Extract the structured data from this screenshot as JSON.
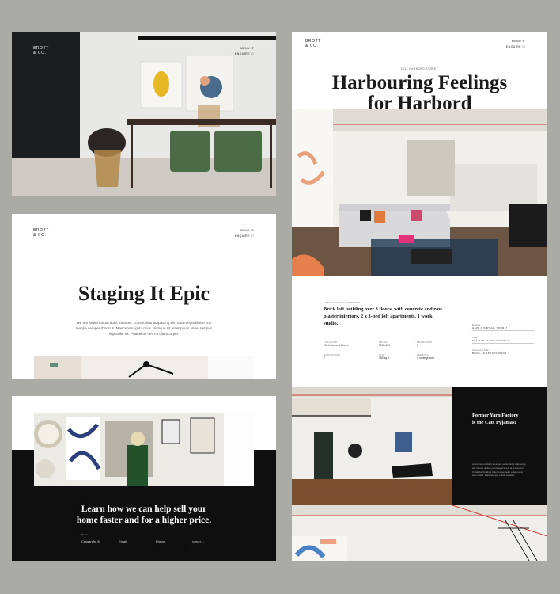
{
  "brand": {
    "logo_line1": "BROTT",
    "logo_line2": "& CO."
  },
  "nav": {
    "menu_label": "MENU ☰",
    "enquire_label": "ENQUIRE ☐"
  },
  "card_staging": {
    "title": "Staging It Epic",
    "body": "We are lorem ipsum dolor sit amet, consectetur adipiscing elit. Etiam eget libero non magna semper rhoncus. Maecenas ligula risus, tristique sit amet purus vitae, tempus imperdiet ex. Phasellus nec mi ullamcorper."
  },
  "card_contact": {
    "headline_line1": "Learn how we can help sell your",
    "headline_line2": "home faster and for a higher price.",
    "fields": [
      {
        "label": "Name",
        "value": "Cassandra M"
      },
      {
        "label": "",
        "value": "Email"
      },
      {
        "label": "",
        "value": "Phone"
      }
    ],
    "submit_label": "SUBMIT →"
  },
  "card_harbord": {
    "address": "1014 HARBORD STREET",
    "title_line1": "Harbouring Feelings",
    "title_line2": "for Harbord",
    "section_label": "CASE STUDY / OVERVIEW",
    "description": "Brick loft building over 3 floors, with concrete and raw plaster interiors. 2 x 3-bed loft apartments, 1 work studio.",
    "details": [
      {
        "label": "LOCATION",
        "value": "1014 Harbord Street"
      },
      {
        "label": "PRICE",
        "value": "$995,000"
      },
      {
        "label": "BEDROOMS",
        "value": "3"
      },
      {
        "label": "BATHROOMS",
        "value": "2"
      },
      {
        "label": "SIZE",
        "value": "180 sq ft"
      },
      {
        "label": "PARKING",
        "value": "1 underground"
      }
    ],
    "links": [
      {
        "label": "Enquire",
        "value": "HAVE A VIRTUAL TOUR ↗"
      },
      {
        "label": "View",
        "value": "SEE THE FLOOR PLANS ↗"
      },
      {
        "label": "Listing For Sale",
        "value": "BOOK AN APPOINTMENT ↗"
      }
    ],
    "feature_title_line1": "Former Yarn Factory",
    "feature_title_line2": "is the Cats Pyjamas!",
    "feature_body": "Lorem ipsum dolor sit amet, consectetur adipiscing elit. Donec dictum purus eget turpis at fermentum. Curabitur tincidunt dolor consectetur euismod at sem mollis. Pellentesque mattis sodales."
  },
  "colors": {
    "background": "#a9aba4",
    "dark": "#0f0f0f",
    "accent_red": "#c9443a"
  }
}
